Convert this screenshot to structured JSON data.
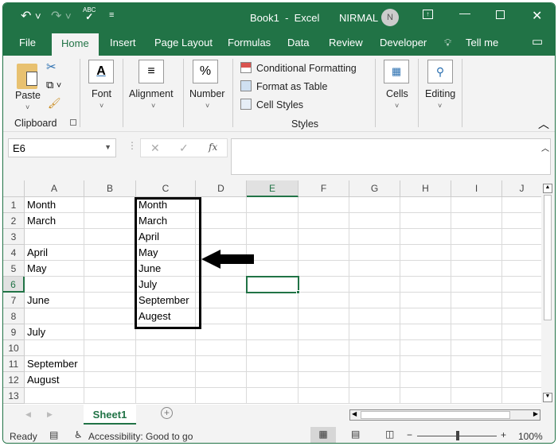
{
  "title": {
    "doc": "Book1  -  Excel",
    "user": "NIRMAL",
    "avatar": "N"
  },
  "tabs": [
    "File",
    "Home",
    "Insert",
    "Page Layout",
    "Formulas",
    "Data",
    "Review",
    "Developer",
    "Tell me"
  ],
  "ribbon": {
    "paste": "Paste",
    "clipboard": "Clipboard",
    "font": "Font",
    "alignment": "Alignment",
    "number": "Number",
    "conditional": "Conditional Formatting",
    "format_table": "Format as Table",
    "cell_styles": "Cell Styles",
    "styles": "Styles",
    "cells": "Cells",
    "editing": "Editing",
    "percent": "%"
  },
  "formula": {
    "name_box": "E6",
    "value": ""
  },
  "columns": [
    "A",
    "B",
    "C",
    "D",
    "E",
    "F",
    "G",
    "H",
    "I",
    "J"
  ],
  "rows": [
    "1",
    "2",
    "3",
    "4",
    "5",
    "6",
    "7",
    "8",
    "9",
    "10",
    "11",
    "12",
    "13"
  ],
  "cells": {
    "A": [
      "Month",
      "March",
      "",
      "April",
      "May",
      "",
      "June",
      "",
      "July",
      "",
      "September",
      "August",
      ""
    ],
    "C": [
      "Month",
      "March",
      "April",
      "May",
      "June",
      "July",
      "September",
      "Augest",
      "",
      "",
      "",
      "",
      ""
    ]
  },
  "selected": {
    "col": "E",
    "row": "6"
  },
  "sheet": {
    "name": "Sheet1"
  },
  "status": {
    "ready": "Ready",
    "accessibility": "Accessibility: Good to go",
    "zoom": "100%",
    "zoom_level": 100
  }
}
